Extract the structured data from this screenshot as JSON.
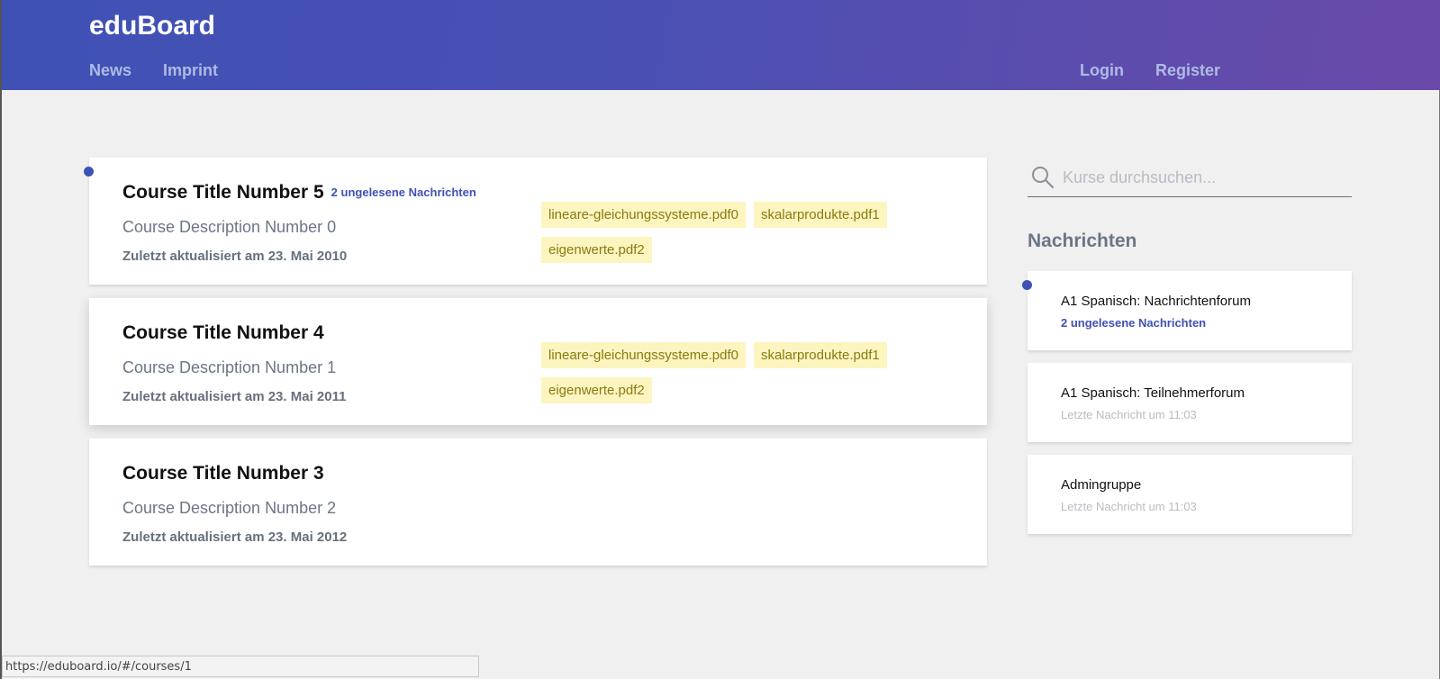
{
  "header": {
    "brand": "eduBoard",
    "nav_left": [
      "News",
      "Imprint"
    ],
    "nav_right": [
      "Login",
      "Register"
    ]
  },
  "courses": [
    {
      "title": "Course Title Number 5",
      "unread": "2 ungelesene Nachrichten",
      "description": "Course Description Number 0",
      "updated": "Zuletzt aktualisiert am 23. Mai 2010",
      "files": [
        "lineare-gleichungssysteme.pdf0",
        "skalarprodukte.pdf1",
        "eigenwerte.pdf2"
      ]
    },
    {
      "title": "Course Title Number 4",
      "description": "Course Description Number 1",
      "updated": "Zuletzt aktualisiert am 23. Mai 2011",
      "files": [
        "lineare-gleichungssysteme.pdf0",
        "skalarprodukte.pdf1",
        "eigenwerte.pdf2"
      ]
    },
    {
      "title": "Course Title Number 3",
      "description": "Course Description Number 2",
      "updated": "Zuletzt aktualisiert am 23. Mai 2012",
      "files": []
    }
  ],
  "search": {
    "placeholder": "Kurse durchsuchen..."
  },
  "messages": {
    "heading": "Nachrichten",
    "items": [
      {
        "title": "A1 Spanisch: Nachrichtenforum",
        "subtitle": "2 ungelesene Nachrichten",
        "unread": true
      },
      {
        "title": "A1 Spanisch: Teilnehmerforum",
        "subtitle": "Letzte Nachricht um 11:03",
        "unread": false
      },
      {
        "title": "Admingruppe",
        "subtitle": "Letzte Nachricht um 11:03",
        "unread": false
      }
    ]
  },
  "status_bar": {
    "url": "https://eduboard.io/#/courses/1"
  },
  "colors": {
    "accent": "#3f51b5",
    "header_gradient_start": "#3f51b5",
    "header_gradient_end": "#6a4aa8",
    "file_tag_bg": "#fcf5c0",
    "file_tag_text": "#8a7a10"
  }
}
